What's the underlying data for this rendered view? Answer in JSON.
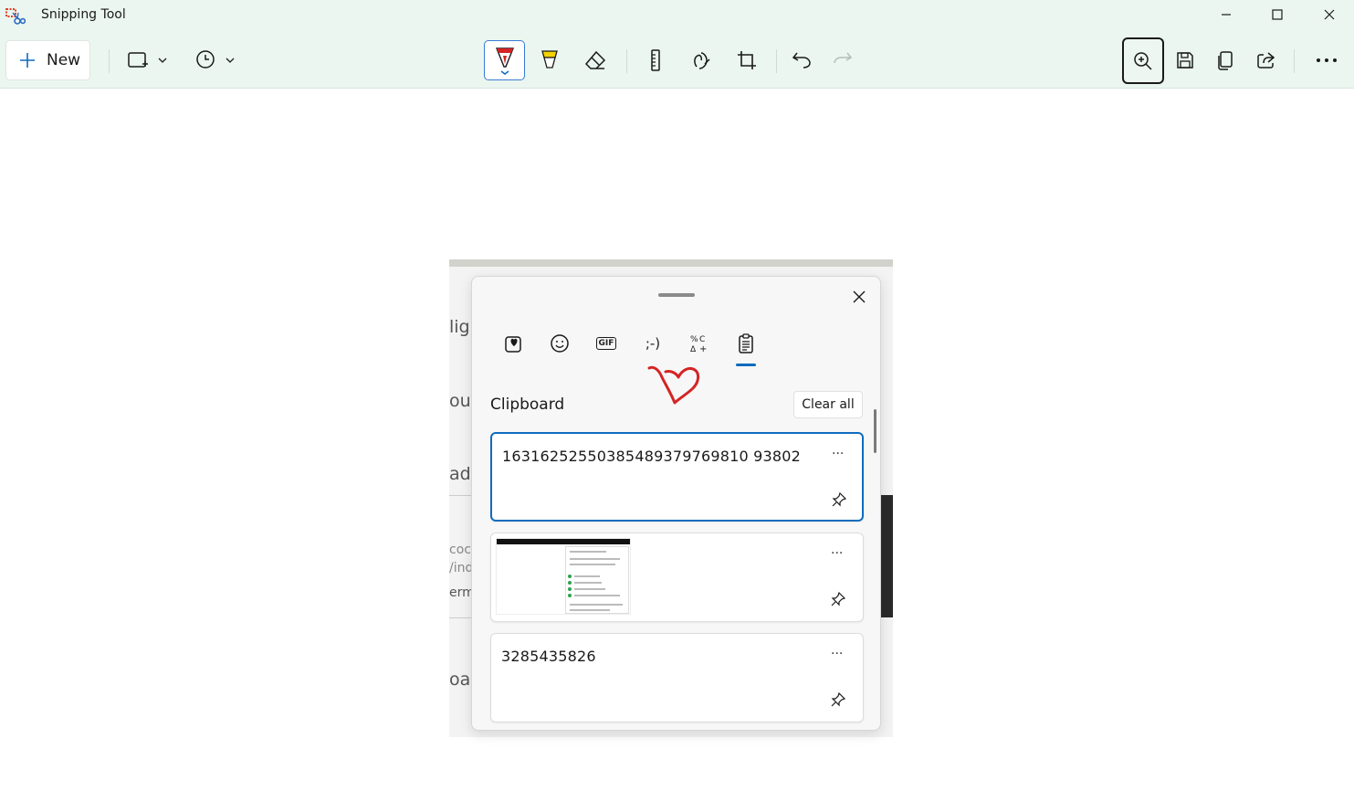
{
  "app": {
    "title": "Snipping Tool"
  },
  "toolbar": {
    "new_label": "New",
    "tools": [
      "snip-mode",
      "delay",
      "ballpoint-pen",
      "highlighter",
      "eraser",
      "ruler",
      "touch-writing",
      "crop",
      "undo",
      "redo",
      "zoom",
      "save",
      "copy",
      "share",
      "more"
    ]
  },
  "snip_fragments": [
    "ligl",
    "ou",
    "ad",
    "coc",
    "/ind",
    "erm",
    "oar"
  ],
  "emoji_panel": {
    "tabs": [
      "favorites-icon",
      "emoji-icon",
      "gif-icon",
      "kaomoji-icon",
      "symbols-icon",
      "clipboard-icon"
    ],
    "active_tab": "clipboard-icon",
    "gif_label": "GIF",
    "kaomoji_label": ";-)",
    "clipboard_title": "Clipboard",
    "clear_all_label": "Clear all",
    "items": [
      {
        "text": "16316252550385489379769810 93802",
        "kind": "text",
        "selected": true
      },
      {
        "text": "",
        "kind": "image",
        "selected": false
      },
      {
        "text": "3285435826",
        "kind": "text",
        "selected": false
      }
    ],
    "more_glyph": "···"
  },
  "colors": {
    "chrome_bg": "#eaf6ef",
    "accent": "#0f6cbd",
    "annotation": "#d42424"
  }
}
